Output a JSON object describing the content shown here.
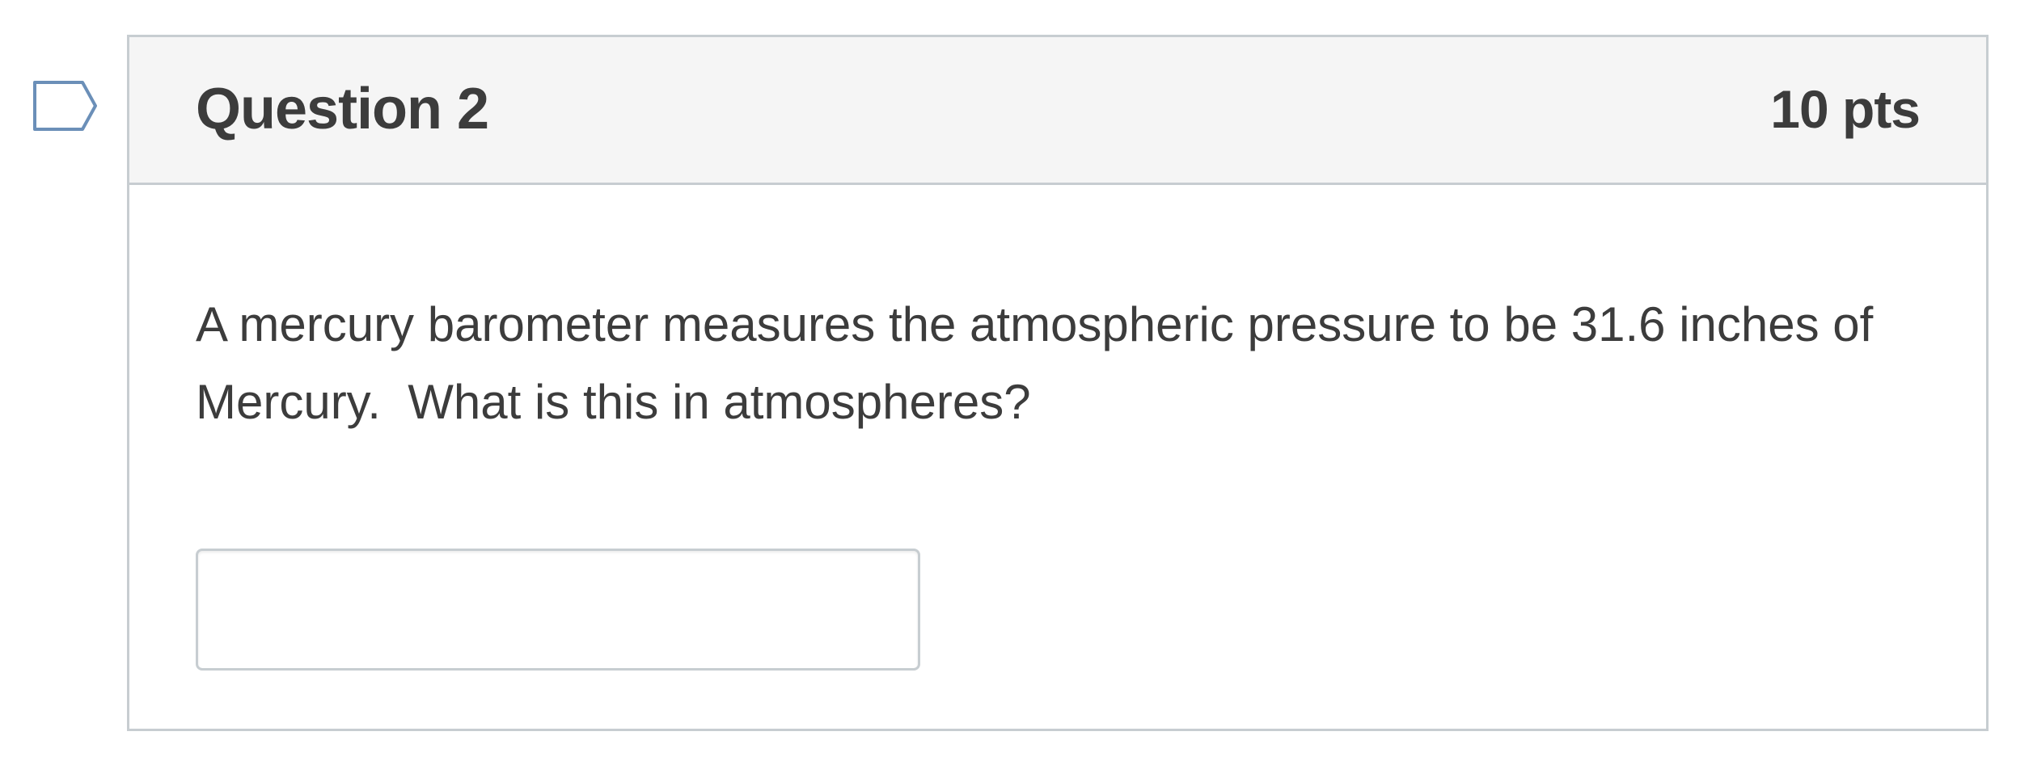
{
  "question": {
    "title": "Question 2",
    "points": "10 pts",
    "text": "A mercury barometer measures the atmospheric pressure to be 31.6 inches of Mercury.  What is this in atmospheres?",
    "answer": {
      "value": "",
      "placeholder": ""
    }
  },
  "icons": {
    "flag": "flag-question-icon"
  },
  "colors": {
    "border": "#c7cdd1",
    "header_bg": "#f5f5f5",
    "flag_stroke": "#6b8fb8",
    "text": "#3c3c3c"
  }
}
